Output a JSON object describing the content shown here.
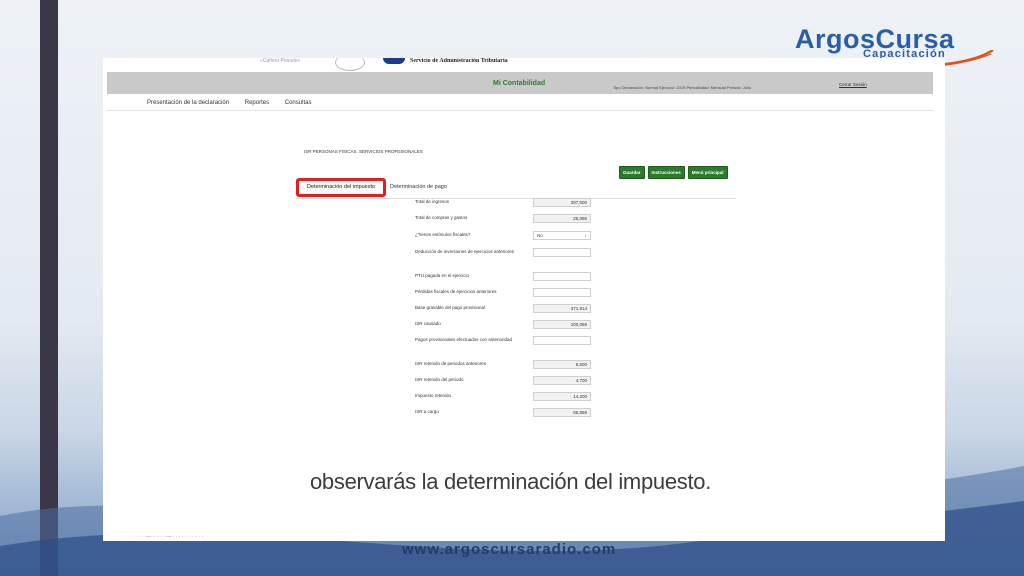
{
  "branding": {
    "logo_text_a": "Argos",
    "logo_text_b": "Cursa",
    "logo_sub": "Capacitación",
    "website": "www.argoscursaradio.com"
  },
  "sat": {
    "small_text": "«Cañero Pesado»",
    "agency_name": "Servicio de Administración Tributaria"
  },
  "app": {
    "title": "Mi Contabilidad",
    "declaration_info": "Tipo Declaración: Normal Ejercicio: 2019 Periodicidad: Mensual Periodo: Julio",
    "logout": "Cerrar Sesión"
  },
  "menu": [
    "Presentación de la declaración",
    "Reportes",
    "Consultas"
  ],
  "form": {
    "title": "ISR PERSONAS FÍSICAS. SERVICIOS PROFESIONALES",
    "buttons": [
      "Guardar",
      "Instrucciones",
      "Menú principal"
    ],
    "tabs": [
      "Determinación del impuesto",
      "Determinación de pago"
    ],
    "fields": [
      {
        "label": "Total de ingresos",
        "value": "397,000",
        "kind": "value"
      },
      {
        "label": "Total de compras y gastos",
        "value": "25,086",
        "kind": "value"
      },
      {
        "label": "¿Tienes estímulos fiscales?",
        "value": "No",
        "kind": "select"
      },
      {
        "label": "Deducción de inversiones de ejercicios anteriores",
        "value": "",
        "kind": "empty"
      },
      {
        "label": "PTU pagada en el ejercicio",
        "value": "",
        "kind": "empty"
      },
      {
        "label": "Pérdidas fiscales de ejercicios anteriores",
        "value": "",
        "kind": "empty"
      },
      {
        "label": "Base gravable del pago provisional",
        "value": "371,914",
        "kind": "value"
      },
      {
        "label": "ISR causado",
        "value": "100,068",
        "kind": "value"
      },
      {
        "label": "Pagos provisionales efectuados con anterioridad",
        "value": "",
        "kind": "empty"
      },
      {
        "label": "ISR retenido de periodos anteriores",
        "value": "6,500",
        "kind": "value"
      },
      {
        "label": "ISR retenido del periodo",
        "value": "4,700",
        "kind": "value"
      },
      {
        "label": "Impuesto retenido",
        "value": "14,200",
        "kind": "value"
      },
      {
        "label": "ISR a cargo",
        "value": "85,868",
        "kind": "value"
      }
    ]
  },
  "caption": "observarás la determinación del impuesto.",
  "bottom_text": "· · · — ·· · · ·  — · · · ·   · · ·  ·· · ·"
}
